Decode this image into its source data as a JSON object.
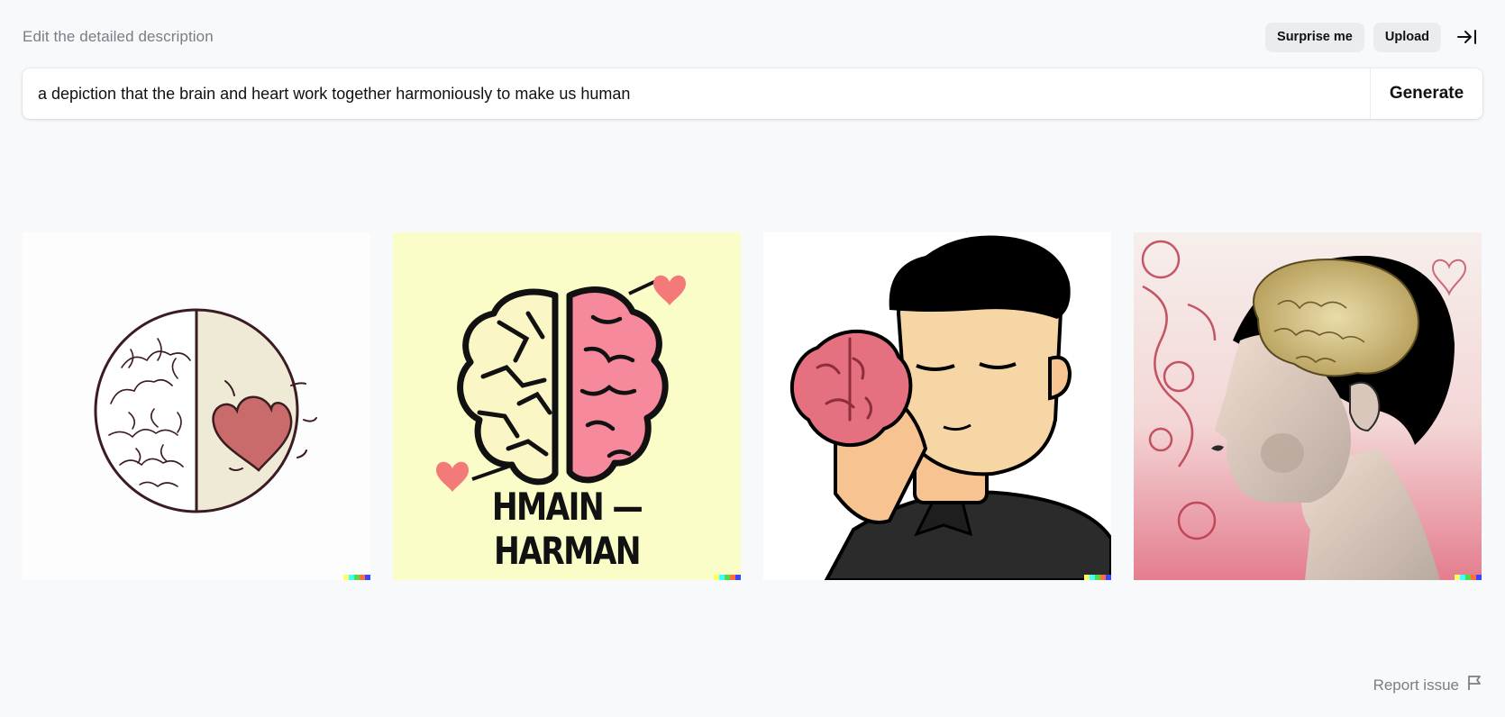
{
  "header": {
    "title": "Edit the detailed description",
    "surprise_label": "Surprise me",
    "upload_label": "Upload"
  },
  "prompt": {
    "value": "a depiction that the brain and heart work together harmoniously to make us human",
    "generate_label": "Generate"
  },
  "results": {
    "tiles": [
      {
        "name": "result-image-1",
        "subject": "half brain half heart circle sketch"
      },
      {
        "name": "result-image-2",
        "subject": "two brains with hearts poster",
        "caption": "HMAIN — HARMAN"
      },
      {
        "name": "result-image-3",
        "subject": "man holding brain cartoon"
      },
      {
        "name": "result-image-4",
        "subject": "woman profile with golden brain"
      }
    ],
    "signature_colors": [
      "#ffff66",
      "#42ffff",
      "#51da4c",
      "#ff6e3c",
      "#3c46ff"
    ]
  },
  "footer": {
    "report_label": "Report issue"
  },
  "colors": {
    "background": "#f8f9fb",
    "muted_text": "#7a7d86",
    "pill_bg": "#ebecef"
  }
}
